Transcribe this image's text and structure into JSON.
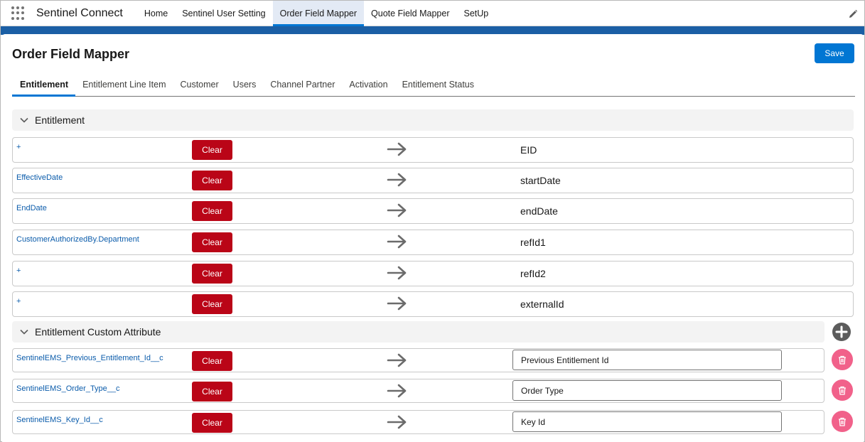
{
  "app": {
    "name": "Sentinel Connect"
  },
  "nav": {
    "tabs": [
      {
        "label": "Home"
      },
      {
        "label": "Sentinel User Setting"
      },
      {
        "label": "Order Field Mapper"
      },
      {
        "label": "Quote Field Mapper"
      },
      {
        "label": "SetUp"
      }
    ],
    "active": "Order Field Mapper"
  },
  "page": {
    "title": "Order Field Mapper",
    "save_label": "Save"
  },
  "subtabs": [
    {
      "label": "Entitlement"
    },
    {
      "label": "Entitlement Line Item"
    },
    {
      "label": "Customer"
    },
    {
      "label": "Users"
    },
    {
      "label": "Channel Partner"
    },
    {
      "label": "Activation"
    },
    {
      "label": "Entitlement Status"
    }
  ],
  "active_subtab": "Entitlement",
  "sections": {
    "entitlement": {
      "title": "Entitlement",
      "rows": [
        {
          "source": "+",
          "clear": "Clear",
          "target": "EID"
        },
        {
          "source": "EffectiveDate",
          "clear": "Clear",
          "target": "startDate"
        },
        {
          "source": "EndDate",
          "clear": "Clear",
          "target": "endDate"
        },
        {
          "source": "CustomerAuthorizedBy.Department",
          "clear": "Clear",
          "target": "refId1"
        },
        {
          "source": "+",
          "clear": "Clear",
          "target": "refId2"
        },
        {
          "source": "+",
          "clear": "Clear",
          "target": "externalId"
        }
      ]
    },
    "custom": {
      "title": "Entitlement Custom Attribute",
      "rows": [
        {
          "source": "SentinelEMS_Previous_Entitlement_Id__c",
          "clear": "Clear",
          "target": "Previous Entitlement Id"
        },
        {
          "source": "SentinelEMS_Order_Type__c",
          "clear": "Clear",
          "target": "Order Type"
        },
        {
          "source": "SentinelEMS_Key_Id__c",
          "clear": "Clear",
          "target": "Key Id"
        }
      ]
    }
  },
  "icons": {
    "app_launcher": "grid-icon",
    "edit": "pencil-icon",
    "section_toggle": "chevron-down-icon",
    "mapping": "arrow-right-icon",
    "add": "plus-circle-icon",
    "delete": "trash-icon"
  },
  "colors": {
    "brand": "#0176d3",
    "danger": "#ba0517",
    "delete": "#f1618a",
    "link": "#0b5cab",
    "band": "#1b5fa5"
  }
}
